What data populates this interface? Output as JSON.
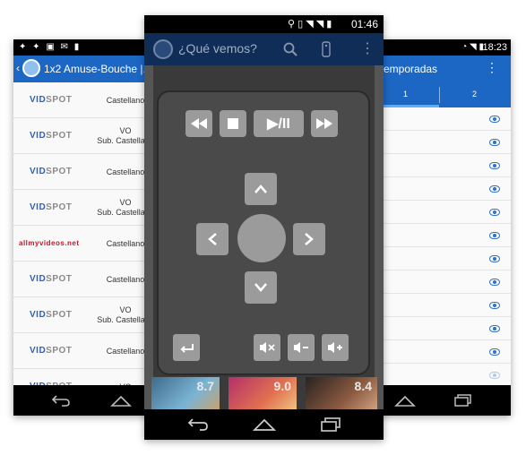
{
  "left_phone": {
    "title": "1x2 Amuse-Bouche |...",
    "rows": [
      {
        "host_a": "VID",
        "host_b": "SPOT",
        "lang": "Castellano"
      },
      {
        "host_a": "VID",
        "host_b": "SPOT",
        "lang": "VO\nSub. Castellano"
      },
      {
        "host_a": "VID",
        "host_b": "SPOT",
        "lang": "Castellano"
      },
      {
        "host_a": "VID",
        "host_b": "SPOT",
        "lang": "VO\nSub. Castellano"
      },
      {
        "host_a": "allmyvideos",
        "host_b": ".net",
        "lang": "Castellano"
      },
      {
        "host_a": "VID",
        "host_b": "SPOT",
        "lang": "Castellano"
      },
      {
        "host_a": "VID",
        "host_b": "SPOT",
        "lang": "VO\nSub. Castellano"
      },
      {
        "host_a": "VID",
        "host_b": "SPOT",
        "lang": "Castellano"
      },
      {
        "host_a": "VID",
        "host_b": "SPOT",
        "lang": "VO"
      }
    ]
  },
  "center_phone": {
    "status_time": "01:46",
    "title": "¿Qué vemos?",
    "scores": [
      "8.7",
      "9.0",
      "8.4"
    ],
    "remote_labels": {
      "play_pause": "▶/II"
    }
  },
  "right_phone": {
    "status_time": "18:23",
    "title": "emporadas",
    "tabs": [
      "1",
      "2"
    ]
  },
  "colors": {
    "accent": "#1c67c4",
    "dark_bar": "#0f2d57",
    "remote_btn": "#9b9b9b"
  }
}
